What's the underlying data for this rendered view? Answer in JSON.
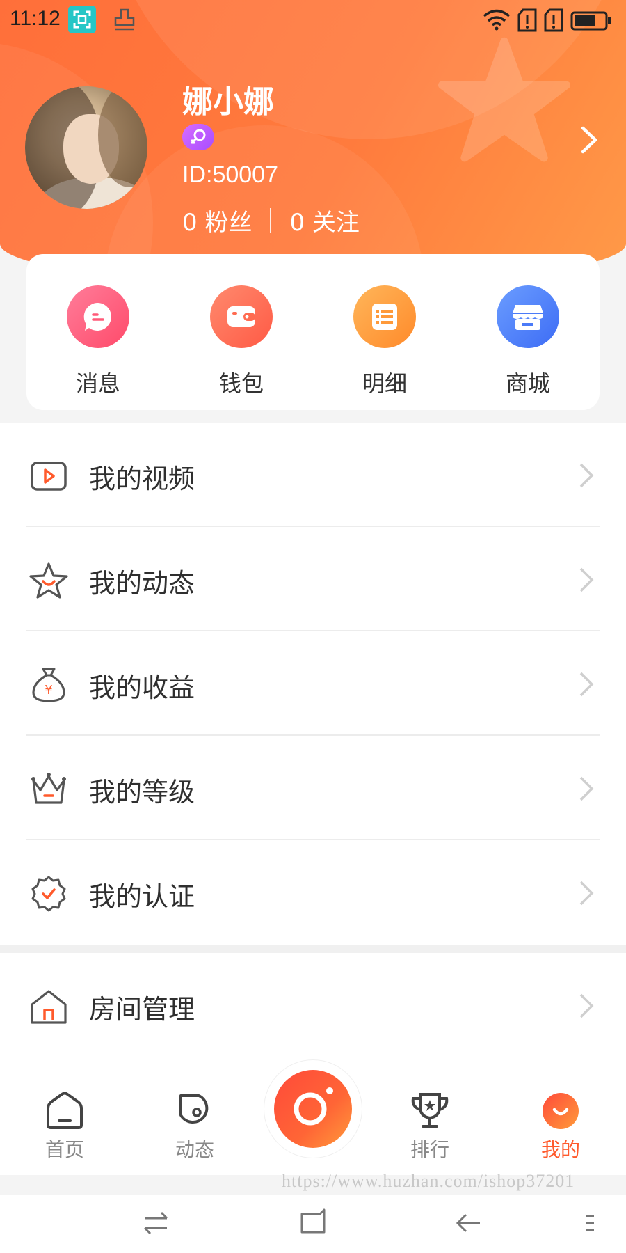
{
  "status_bar": {
    "time": "11:12",
    "icons": [
      "screenshot-icon",
      "stamp-icon",
      "wifi-icon",
      "sim-icon",
      "sim-icon",
      "battery-icon"
    ]
  },
  "profile": {
    "name": "娜小娜",
    "id_text": "ID:50007",
    "fans": "0 粉丝",
    "following": "0 关注",
    "gender_icon": "female-icon"
  },
  "quick_actions": [
    {
      "label": "消息",
      "icon": "chat-bubble-icon",
      "color_from": "#ff7d9a",
      "color_to": "#ff4a6a"
    },
    {
      "label": "钱包",
      "icon": "wallet-icon",
      "color_from": "#ff8a6e",
      "color_to": "#ff5a45"
    },
    {
      "label": "明细",
      "icon": "list-icon",
      "color_from": "#ffb65a",
      "color_to": "#ff8a2a"
    },
    {
      "label": "商城",
      "icon": "store-icon",
      "color_from": "#6b9dff",
      "color_to": "#3d6cf5"
    }
  ],
  "menu": [
    {
      "label": "我的视频",
      "icon": "video-icon"
    },
    {
      "label": "我的动态",
      "icon": "star-smile-icon"
    },
    {
      "label": "我的收益",
      "icon": "money-bag-icon"
    },
    {
      "label": "我的等级",
      "icon": "crown-icon"
    },
    {
      "label": "我的认证",
      "icon": "verified-badge-icon"
    },
    {
      "label": "房间管理",
      "icon": "house-icon"
    }
  ],
  "bottom_nav": [
    {
      "label": "首页",
      "icon": "home-icon"
    },
    {
      "label": "动态",
      "icon": "moment-icon"
    },
    {
      "label": "排行",
      "icon": "trophy-icon"
    },
    {
      "label": "我的",
      "icon": "smile-profile-icon",
      "active": true
    }
  ],
  "watermark": "https://www.huzhan.com/ishop37201",
  "colors": {
    "accent": "#ff6b35",
    "active_nav": "#ff5a2c"
  }
}
